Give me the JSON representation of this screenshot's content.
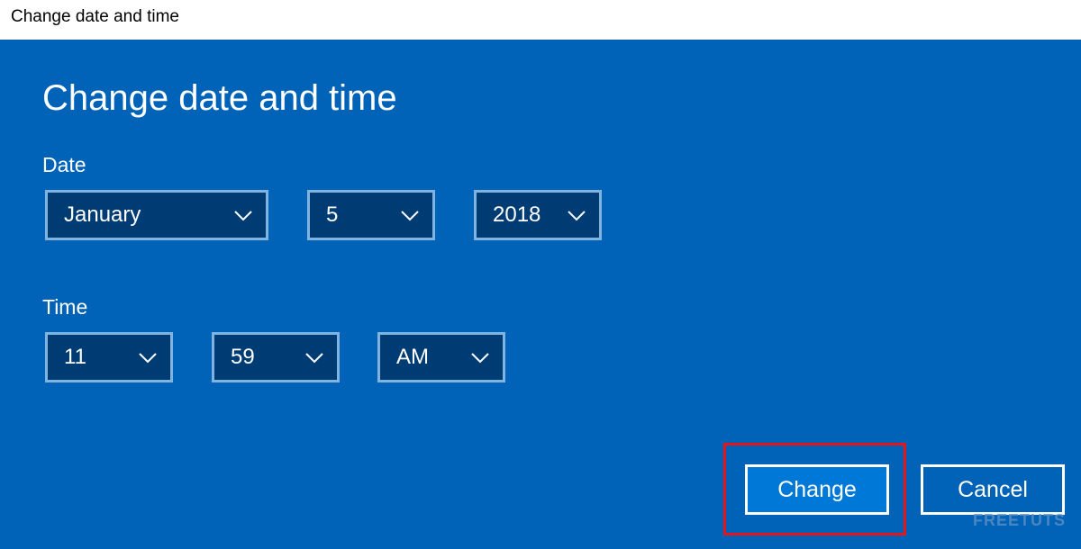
{
  "window": {
    "title": "Change date and time"
  },
  "dialog": {
    "heading": "Change date and time",
    "date_label": "Date",
    "time_label": "Time"
  },
  "date": {
    "month": "January",
    "day": "5",
    "year": "2018"
  },
  "time": {
    "hour": "11",
    "minute": "59",
    "period": "AM"
  },
  "buttons": {
    "change": "Change",
    "cancel": "Cancel"
  },
  "watermark": "FREETUTS",
  "icons": {
    "dropdown": "chevron-down-icon"
  },
  "colors": {
    "panel_background": "#0063b8",
    "select_background": "#003c74",
    "select_border": "#7fb3e0",
    "primary_button": "#0078d7",
    "highlight": "#e8141b",
    "text": "#ffffff"
  }
}
